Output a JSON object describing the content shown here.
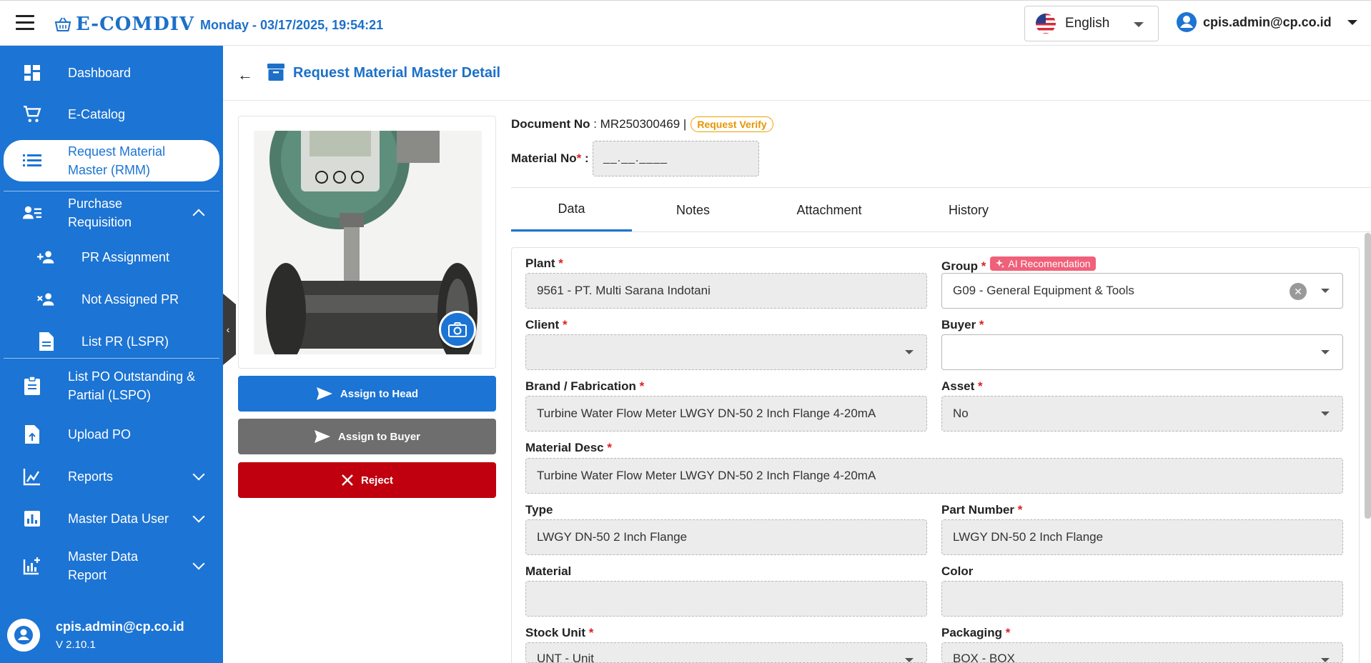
{
  "app": {
    "brand": "E-COMDIV",
    "datetime": "Monday - 03/17/2025, 19:54:21",
    "language": "English",
    "user_email": "cpis.admin@cp.co.id",
    "version": "V 2.10.1"
  },
  "colors": {
    "primary": "#1c74d4",
    "reject": "#c0000e",
    "neutral_button": "#6e6e6e",
    "badge_verify": "#e69500",
    "ai_badge": "#f0607a"
  },
  "sidebar": {
    "items": [
      {
        "label": "Dashboard",
        "icon": "dashboard-icon"
      },
      {
        "label": "E-Catalog",
        "icon": "cart-icon"
      },
      {
        "label": "Request Material Master (RMM)",
        "icon": "list-icon"
      },
      {
        "label": "Purchase Requisition",
        "icon": "person-list-icon"
      },
      {
        "label": "PR Assignment",
        "icon": "person-add-icon"
      },
      {
        "label": "Not Assigned PR",
        "icon": "person-remove-icon"
      },
      {
        "label": "List PR (LSPR)",
        "icon": "document-icon"
      },
      {
        "label": "List PO Outstanding & Partial (LSPO)",
        "icon": "clipboard-icon"
      },
      {
        "label": "Upload PO",
        "icon": "file-upload-icon"
      },
      {
        "label": "Reports",
        "icon": "chart-icon"
      },
      {
        "label": "Master Data User",
        "icon": "bar-chart-icon"
      },
      {
        "label": "Master Data Report",
        "icon": "report-add-icon"
      }
    ]
  },
  "page": {
    "title": "Request Material Master Detail",
    "document_label": "Document No",
    "document_no": "MR250300469",
    "status": "Request Verify",
    "material_no_label": "Material No",
    "material_no_value": "__.__.____"
  },
  "actions": {
    "assign_head": "Assign to Head",
    "assign_buyer": "Assign to Buyer",
    "reject": "Reject"
  },
  "tabs": [
    "Data",
    "Notes",
    "Attachment",
    "History"
  ],
  "form": {
    "plant": {
      "label": "Plant",
      "value": "9561 - PT. Multi Sarana Indotani"
    },
    "group": {
      "label": "Group",
      "value": "G09 - General Equipment & Tools",
      "ai": "AI Recomendation"
    },
    "client": {
      "label": "Client",
      "value": ""
    },
    "buyer": {
      "label": "Buyer",
      "value": ""
    },
    "brand": {
      "label": "Brand / Fabrication",
      "value": "Turbine Water Flow Meter LWGY DN-50 2 Inch Flange 4-20mA"
    },
    "asset": {
      "label": "Asset",
      "value": "No"
    },
    "material_desc": {
      "label": "Material Desc",
      "value": "Turbine Water Flow Meter LWGY DN-50 2 Inch Flange 4-20mA"
    },
    "type": {
      "label": "Type",
      "value": "LWGY DN-50 2 Inch Flange"
    },
    "part_number": {
      "label": "Part Number",
      "value": "LWGY DN-50 2 Inch Flange"
    },
    "material": {
      "label": "Material",
      "value": ""
    },
    "color": {
      "label": "Color",
      "value": ""
    },
    "stock_unit": {
      "label": "Stock Unit",
      "value": "UNT - Unit"
    },
    "packaging": {
      "label": "Packaging",
      "value": "BOX - BOX"
    }
  }
}
